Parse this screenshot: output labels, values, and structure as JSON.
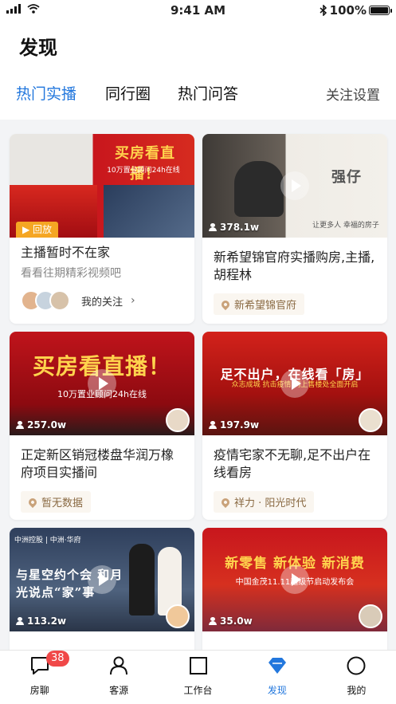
{
  "status": {
    "time": "9:41 AM",
    "battery": "100%",
    "battery_level": 1.0
  },
  "page": {
    "title": "发现"
  },
  "tabs": [
    {
      "label": "热门实播",
      "active": true
    },
    {
      "label": "同行圈",
      "active": false
    },
    {
      "label": "热门问答",
      "active": false
    }
  ],
  "settings_label": "关注设置",
  "colors": {
    "accent": "#2277dd",
    "badge": "#f04848",
    "replay": "#f5a623"
  },
  "cards": [
    {
      "title": "主播暂时不在家",
      "subtitle": "看看往期精彩视频吧",
      "badge": "回放",
      "thumb_title": "买房看直播！",
      "thumb_sub": "10万置业顾问24h在线",
      "follow_label": "我的关注"
    },
    {
      "title": "新希望锦官府实播购房,主播,胡程林",
      "views": "378.1w",
      "location": "新希望锦官府",
      "thumb_title": "强仔",
      "thumb_sub": "让更多人 幸福的房子"
    },
    {
      "title": "正定新区销冠楼盘华润万橡府项目实播间",
      "views": "257.0w",
      "location": "暂无数据",
      "thumb_title": "买房看直播！",
      "thumb_sub": "10万置业顾问24h在线"
    },
    {
      "title": "疫情宅家不无聊,足不出户在线看房",
      "views": "197.9w",
      "location": "祥力 · 阳光时代",
      "thumb_title": "足不出户，在线看「房」",
      "thumb_sub": "众志成城 抗击疫情 网上售楼处全面开启"
    },
    {
      "title": "",
      "views": "113.2w",
      "thumb_title": "与星空约个会 和月光说点“家”事",
      "thumb_sub": "中洲控股 | 中洲·华府"
    },
    {
      "title": "",
      "views": "35.0w",
      "thumb_title": "新零售 新体验 新消费",
      "thumb_sub": "中国金茂11.11超级节启动发布会"
    }
  ],
  "tabbar": {
    "items": [
      {
        "label": "房聊",
        "icon": "chat-icon"
      },
      {
        "label": "客源",
        "icon": "person-icon"
      },
      {
        "label": "工作台",
        "icon": "square-icon"
      },
      {
        "label": "发现",
        "icon": "diamond-icon",
        "active": true
      },
      {
        "label": "我的",
        "icon": "circle-icon"
      }
    ],
    "chat_badge": "38"
  }
}
